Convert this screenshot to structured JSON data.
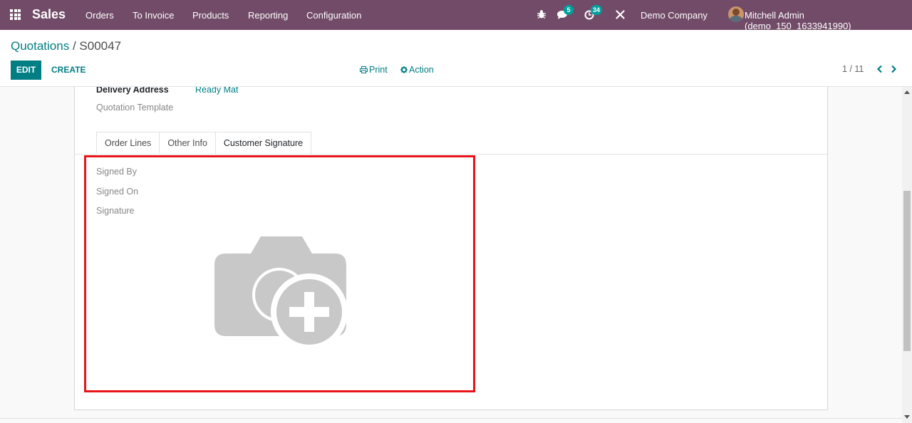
{
  "navbar": {
    "app_name": "Sales",
    "menu": [
      "Orders",
      "To Invoice",
      "Products",
      "Reporting",
      "Configuration"
    ],
    "messages_count": "5",
    "activities_count": "34",
    "company": "Demo Company",
    "user": "Mitchell Admin (demo_150_1633941990)"
  },
  "breadcrumb": {
    "parent": "Quotations",
    "separator": " / ",
    "current": "S00047"
  },
  "actions": {
    "edit": "EDIT",
    "create": "CREATE",
    "print": "Print",
    "action": "Action"
  },
  "pager": {
    "value": "1 / 11"
  },
  "form": {
    "delivery_address_label": "Delivery Address",
    "delivery_address_value": "Ready Mat",
    "quotation_template_label": "Quotation Template",
    "tabs": [
      "Order Lines",
      "Other Info",
      "Customer Signature"
    ],
    "active_tab": "Customer Signature",
    "signature": {
      "signed_by_label": "Signed By",
      "signed_on_label": "Signed On",
      "signature_label": "Signature"
    }
  },
  "colors": {
    "navbar": "#714b67",
    "primary": "#017e84",
    "badge": "#00a09d",
    "highlight": "#e8141a",
    "placeholder_icon": "#c8c8c8"
  },
  "icons": [
    "apps-icon",
    "bug-icon",
    "chat-icon",
    "clock-icon",
    "tools-icon",
    "print-icon",
    "gear-icon",
    "chevron-left-icon",
    "chevron-right-icon",
    "camera-plus-icon"
  ]
}
